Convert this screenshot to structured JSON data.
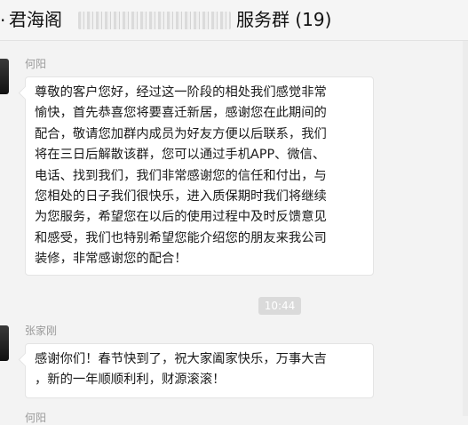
{
  "header": {
    "title_prefix": "·",
    "group_name": "君海阁",
    "group_suffix": "服务群 (19)"
  },
  "messages": [
    {
      "sender": "何阳",
      "text": "尊敬的客户您好，经过这一阶段的相处我们感觉非常\n愉快，首先恭喜您将要喜迁新居，感谢您在此期间的\n配合，敬请您加群内成员为好友方便以后联系，我们\n将在三日后解散该群，您可以通过手机APP、微信、\n电话、找到我们，我们非常感谢您的信任和付出，与\n您相处的日子我们很快乐，进入质保期时我们将继续\n为您服务，希望您在以后的使用过程中及时反馈意见\n和感受，我们也特别希望您能介绍您的朋友来我公司\n装修，非常感谢您的配合！"
    },
    {
      "sender": "张家刚",
      "text": "感谢你们！春节快到了，祝大家阖家快乐，万事大吉\n，新的一年顺顺利利，财源滚滚！"
    }
  ],
  "timestamp": "10:44",
  "partial_sender": "何阳"
}
